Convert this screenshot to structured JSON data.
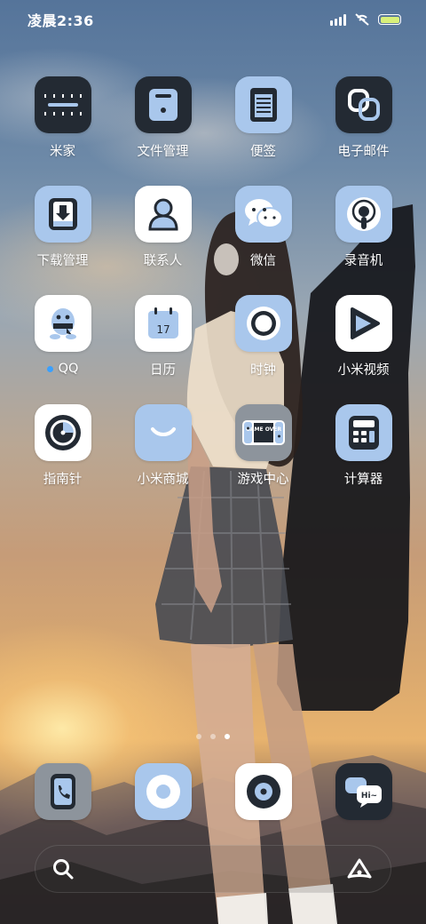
{
  "status_bar": {
    "time": "凌晨2:36",
    "battery_color": "#d8f07a"
  },
  "apps": [
    {
      "label": "米家",
      "icon": "mijia-icon",
      "style": "dark"
    },
    {
      "label": "文件管理",
      "icon": "file-manager-icon",
      "style": "dark"
    },
    {
      "label": "便签",
      "icon": "notes-icon",
      "style": "blue"
    },
    {
      "label": "电子邮件",
      "icon": "email-icon",
      "style": "dark"
    },
    {
      "label": "下载管理",
      "icon": "download-icon",
      "style": "blue"
    },
    {
      "label": "联系人",
      "icon": "contacts-icon",
      "style": "white"
    },
    {
      "label": "微信",
      "icon": "wechat-icon",
      "style": "blue"
    },
    {
      "label": "录音机",
      "icon": "recorder-icon",
      "style": "blue"
    },
    {
      "label": "QQ",
      "icon": "qq-icon",
      "style": "white",
      "new_dot": true
    },
    {
      "label": "日历",
      "icon": "calendar-icon",
      "style": "white",
      "date": "17"
    },
    {
      "label": "时钟",
      "icon": "clock-icon",
      "style": "blue"
    },
    {
      "label": "小米视频",
      "icon": "video-icon",
      "style": "white"
    },
    {
      "label": "指南针",
      "icon": "compass-icon",
      "style": "white"
    },
    {
      "label": "小米商城",
      "icon": "mi-store-icon",
      "style": "blue"
    },
    {
      "label": "游戏中心",
      "icon": "game-center-icon",
      "style": "gray",
      "screen_text": "GAME OVER"
    },
    {
      "label": "计算器",
      "icon": "calculator-icon",
      "style": "blue"
    }
  ],
  "pager": {
    "pages": 3,
    "current": 3
  },
  "dock": [
    {
      "icon": "phone-icon",
      "style": "gray"
    },
    {
      "icon": "messages-icon",
      "style": "blue"
    },
    {
      "icon": "music-icon",
      "style": "white"
    },
    {
      "icon": "chat-bubble-icon",
      "style": "dark",
      "bubble_text": "Hi~"
    }
  ],
  "search": {
    "icon": "search-icon",
    "assistant_icon": "assistant-icon"
  }
}
